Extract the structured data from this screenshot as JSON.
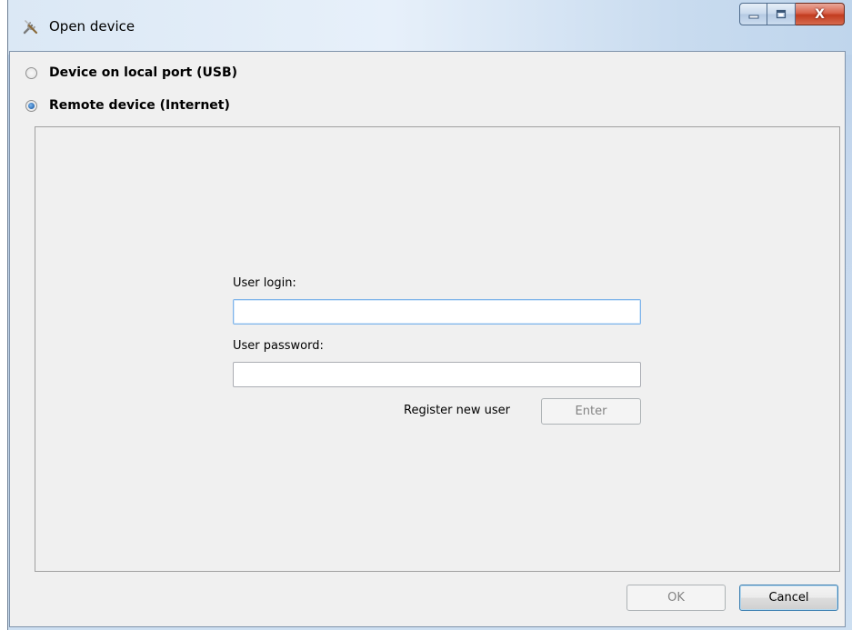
{
  "window": {
    "title": "Open device",
    "icon": "tools-icon",
    "controls": {
      "minimize": "minimize-icon",
      "maximize": "maximize-icon",
      "close": "X"
    }
  },
  "connection": {
    "options": [
      {
        "label": "Device on local port (USB)",
        "checked": false
      },
      {
        "label": "Remote device (Internet)",
        "checked": true
      }
    ]
  },
  "login": {
    "user_login_label": "User login:",
    "user_login_value": "",
    "user_password_label": "User password:",
    "user_password_value": "",
    "register_label": "Register new user",
    "enter_label": "Enter"
  },
  "footer": {
    "ok_label": "OK",
    "cancel_label": "Cancel"
  }
}
